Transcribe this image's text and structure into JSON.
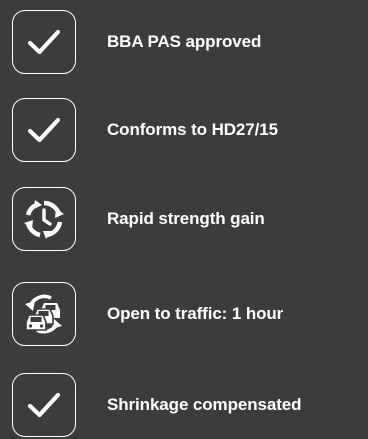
{
  "features": [
    {
      "icon": "checkmark-icon",
      "label": "BBA PAS approved"
    },
    {
      "icon": "checkmark-icon",
      "label": "Conforms to HD27/15"
    },
    {
      "icon": "clock-arrows-icon",
      "label": "Rapid strength gain"
    },
    {
      "icon": "traffic-cars-icon",
      "label": "Open to traffic: 1 hour"
    },
    {
      "icon": "checkmark-icon",
      "label": "Shrinkage compensated"
    }
  ],
  "colors": {
    "background": "#3b3d3d",
    "foreground": "#ffffff"
  }
}
